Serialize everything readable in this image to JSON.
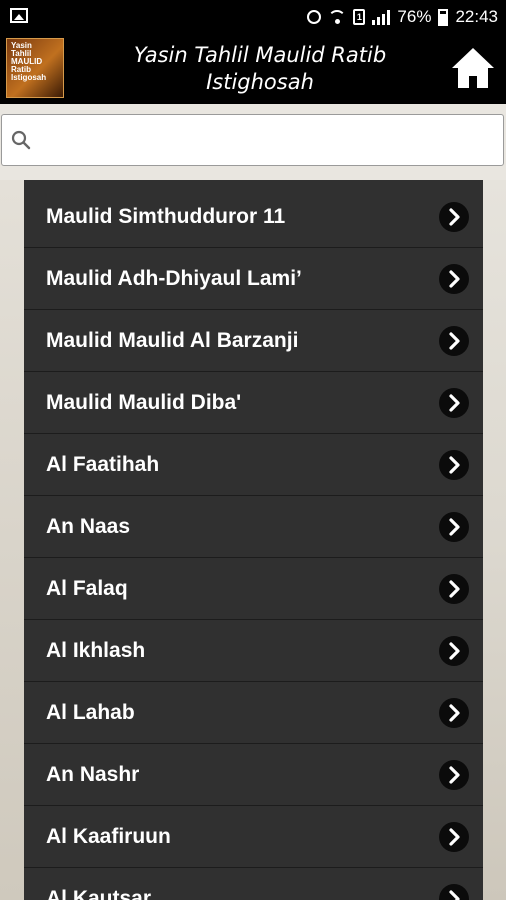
{
  "status_bar": {
    "battery_text": "76%",
    "time": "22:43",
    "sim_label": "1"
  },
  "app": {
    "title_line1": "Yasin Tahlil Maulid Ratib",
    "title_line2": "Istighosah",
    "logo_lines": [
      "Yasin",
      "Tahlil",
      "MAULID",
      "Ratib",
      "Istigosah"
    ]
  },
  "search": {
    "placeholder": "",
    "value": ""
  },
  "list": {
    "items": [
      "Maulid Simthudduror 11",
      "Maulid Adh-Dhiyaul Lami’",
      "Maulid Maulid Al Barzanji",
      "Maulid Maulid Diba'",
      "Al Faatihah",
      "An Naas",
      "Al Falaq",
      "Al Ikhlash",
      "Al Lahab",
      "An Nashr",
      "Al Kaafiruun",
      "Al Kautsar"
    ]
  },
  "colors": {
    "list_bg": "#303030",
    "bar_bg": "#000000",
    "chevron_bg": "#0b0b0b"
  }
}
